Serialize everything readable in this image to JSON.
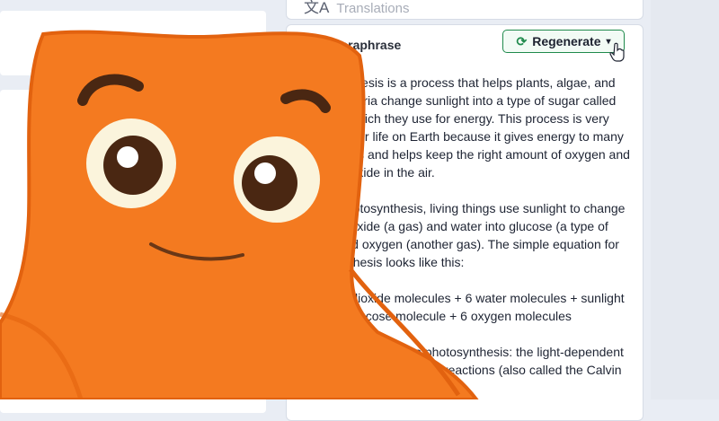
{
  "header_card": {
    "translations_label": "Translations"
  },
  "panel": {
    "title": "Paraphrase",
    "regenerate_label": "Regenerate",
    "paragraphs": [
      "Photosynthesis is a process that helps plants, algae, and some bacteria change sunlight into a type of sugar called glucose, which they use for energy. This process is very important for life on Earth because it gives energy to many living things and helps keep the right amount of oxygen and carbon dioxide in the air.",
      "During photosynthesis, living things use sunlight to change carbon dioxide (a gas) and water into glucose (a type of sugar) and oxygen (another gas). The simple equation for photosynthesis looks like this:",
      "6 carbon dioxide molecules + 6 water molecules + sunlight → into 1 glucose molecule + 6 oxygen molecules",
      "There are two parts to photosynthesis: the light-dependent and the light-independent reactions (also called the Calvin cycle). The light"
    ]
  },
  "colors": {
    "mascot_body": "#f47a20",
    "mascot_outline": "#e2620f",
    "accent_green": "#1f8a4c",
    "page_bg": "#e9edf4"
  },
  "icons": {
    "translate": "translate-icon",
    "regenerate": "refresh-icon",
    "dropdown": "chevron-down-icon",
    "cursor": "hand-pointer-icon"
  }
}
